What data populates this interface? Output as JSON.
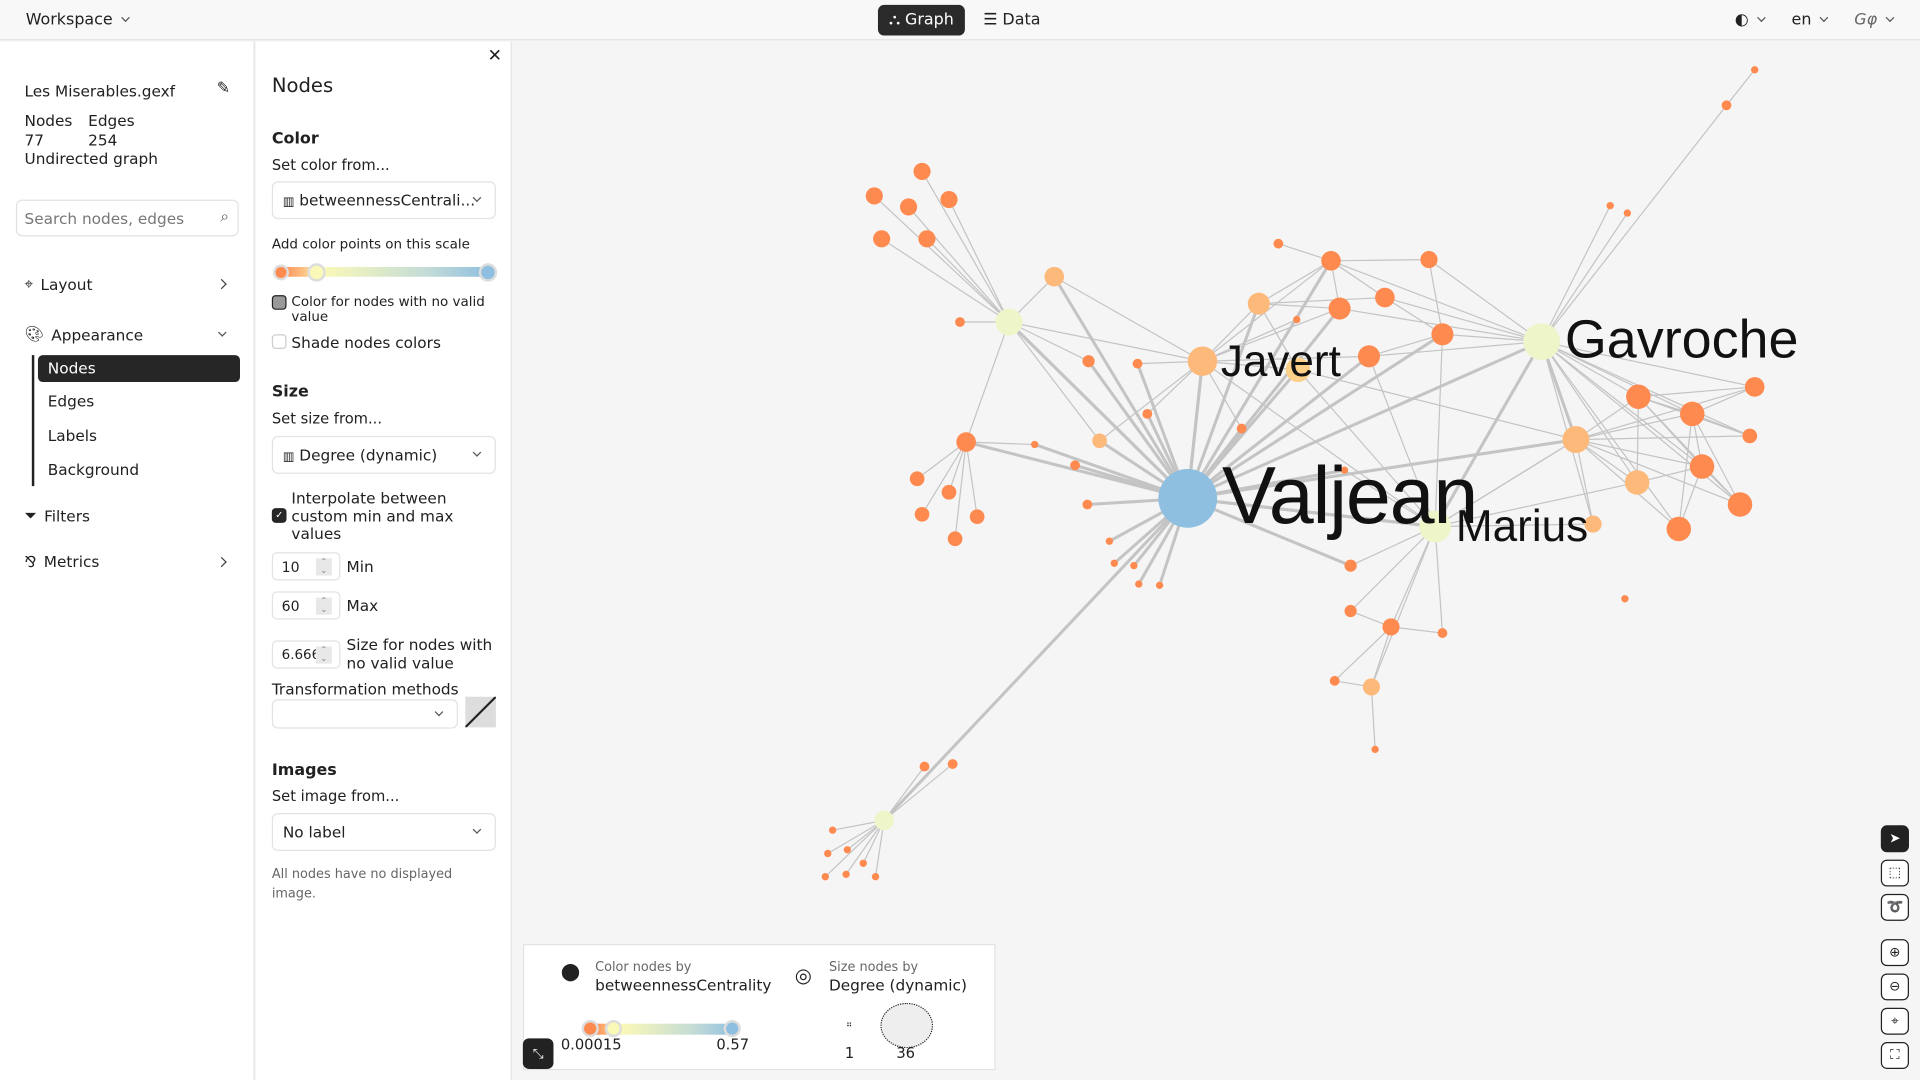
{
  "topbar": {
    "workspace": "Workspace",
    "tabs": [
      {
        "label": "Graph",
        "active": true,
        "icon": "graph-icon"
      },
      {
        "label": "Data",
        "active": false,
        "icon": "table-icon"
      }
    ],
    "language": "en"
  },
  "file": {
    "name": "Les Miserables.gexf",
    "nodes_label": "Nodes",
    "edges_label": "Edges",
    "nodes": "77",
    "edges": "254",
    "type": "Undirected graph"
  },
  "search": {
    "placeholder": "Search nodes, edges"
  },
  "nav": {
    "layout": "Layout",
    "appearance": "Appearance",
    "sub": [
      "Nodes",
      "Edges",
      "Labels",
      "Background"
    ],
    "filters": "Filters",
    "metrics": "Metrics"
  },
  "panel": {
    "title": "Nodes",
    "color": {
      "heading": "Color",
      "set_from": "Set color from...",
      "attribute": "betweennessCentrali...",
      "points_label": "Add color points on this scale",
      "no_value_label": "Color for nodes with no valid value",
      "no_value_color": "#999999",
      "shade_label": "Shade nodes colors",
      "shade_checked": false
    },
    "size": {
      "heading": "Size",
      "set_from": "Set size from...",
      "attribute": "Degree (dynamic)",
      "interpolate_label": "Interpolate between custom min and max values",
      "interpolate_checked": true,
      "min": "10",
      "min_label": "Min",
      "max": "60",
      "max_label": "Max",
      "no_value": "6.666",
      "no_value_label": "Size for nodes with no valid value",
      "transform_label": "Transformation methods",
      "transform_value": ""
    },
    "images": {
      "heading": "Images",
      "set_from": "Set image from...",
      "attribute": "No label",
      "note": "All nodes have no displayed image."
    }
  },
  "colors": {
    "min": "#ff8a50",
    "mid": "#fbf9b8",
    "max": "#8fbfe0",
    "accent": "#262626"
  },
  "graph": {
    "labels": {
      "valjean": "Valjean",
      "javert": "Javert",
      "gavroche": "Gavroche",
      "marius": "Marius"
    }
  },
  "legend": {
    "color_title": "Color nodes by",
    "color_attr": "betweennessCentrality",
    "color_min": "0.00015",
    "color_max": "0.57",
    "size_title": "Size nodes by",
    "size_attr": "Degree (dynamic)",
    "size_min": "1",
    "size_max": "36"
  }
}
